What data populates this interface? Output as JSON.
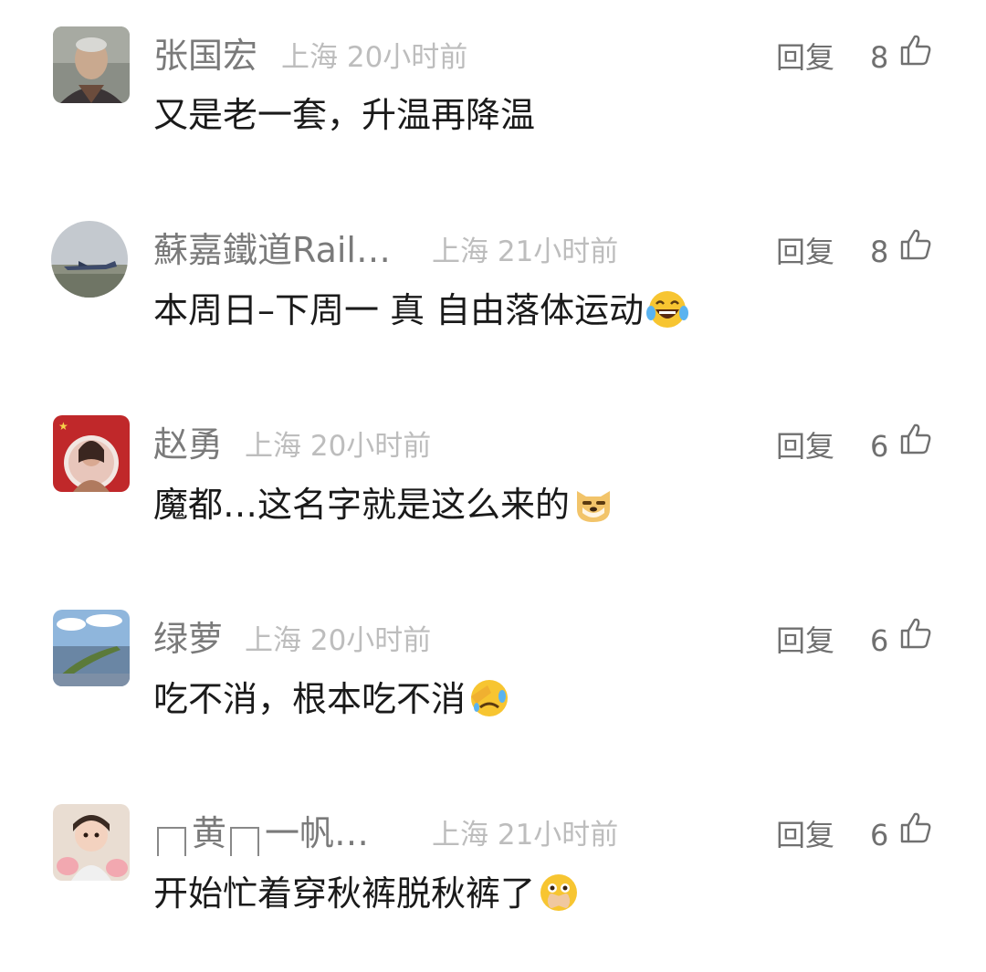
{
  "comments": [
    {
      "name": "张国宏",
      "location": "上海",
      "time": "20小时前",
      "reply_label": "回复",
      "likes": "8",
      "text": "又是老一套，升温再降温",
      "emoji": ""
    },
    {
      "name": "蘇嘉鐵道Rail…",
      "location": "上海",
      "time": "21小时前",
      "reply_label": "回复",
      "likes": "8",
      "text": "本周日–下周一 真 自由落体运动",
      "emoji": "laughing-tears-emoji"
    },
    {
      "name": "赵勇",
      "location": "上海",
      "time": "20小时前",
      "reply_label": "回复",
      "likes": "6",
      "text": "魔都…这名字就是这么来的",
      "emoji": "doge-emoji"
    },
    {
      "name": "绿萝",
      "location": "上海",
      "time": "20小时前",
      "reply_label": "回复",
      "likes": "6",
      "text": "吃不消，根本吃不消",
      "emoji": "facepalm-crying-emoji"
    },
    {
      "name_parts": [
        "黄",
        "一帆…"
      ],
      "location": "上海",
      "time": "21小时前",
      "reply_label": "回复",
      "likes": "6",
      "text": "开始忙着穿秋裤脱秋裤了",
      "emoji": "shushing-emoji"
    }
  ],
  "colors": {
    "name": "#7a7a7a",
    "meta": "#bdbdbd",
    "action": "#707070",
    "text": "#1a1a1a"
  },
  "icons": {
    "like": "thumbs-up-outline-icon"
  }
}
